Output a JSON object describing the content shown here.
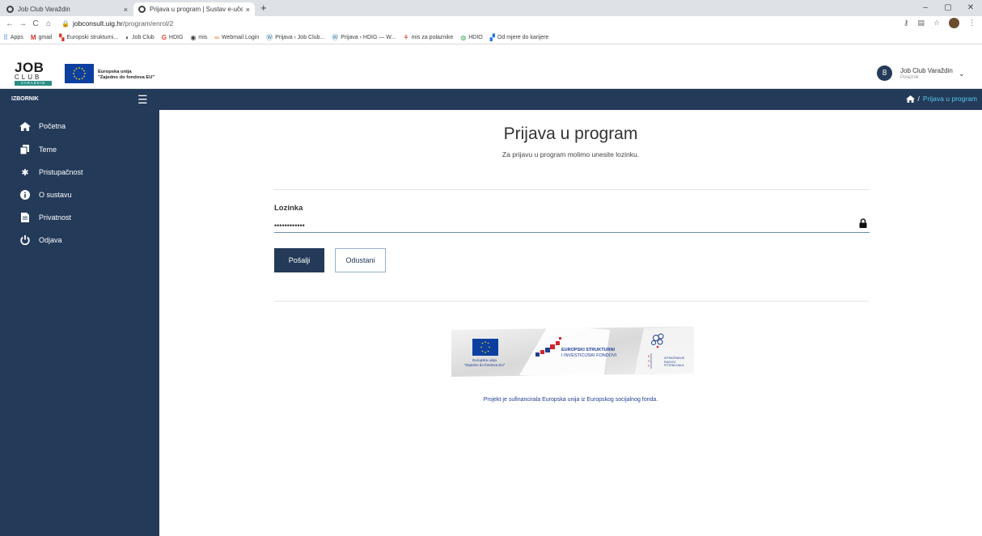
{
  "browser": {
    "tabs": [
      {
        "title": "Job Club Varaždin",
        "close": "×"
      },
      {
        "title": "Prijava u program | Sustav e-učen",
        "close": "×"
      }
    ],
    "new_tab": "+",
    "window_buttons": [
      "–",
      "▢",
      "✕"
    ],
    "nav": [
      "←",
      "→",
      "C",
      "⌂"
    ],
    "url_host": "jobconsult.uig.hr",
    "url_path": "/program/enrol/2",
    "bookmarks": [
      "Apps",
      "gmail",
      "Europski strukturni...",
      "Job Club",
      "HDIG",
      "mis",
      "Webmail Login",
      "Prijava ‹ Job Club...",
      "Prijava ‹ HDIG — W...",
      "mis za polaznike",
      "HDIO",
      "Od mjere do karijere"
    ]
  },
  "header": {
    "logo_line1": "JOB",
    "logo_line2": "CLUB",
    "logo_line3": "VARAŽDIN",
    "eu_line1": "Europska unija",
    "eu_line2": "\"Zajedno do fondova EU\"",
    "user_initial": "8",
    "user_name": "Job Club Varaždin",
    "user_role": "Polaznik",
    "user_caret": "⌄"
  },
  "topbar": {
    "menu_label": "IZBORNIK",
    "breadcrumb_sep": "/",
    "breadcrumb_current": "Prijava u program"
  },
  "sidebar": {
    "items": [
      {
        "label": "Početna"
      },
      {
        "label": "Teme"
      },
      {
        "label": "Pristupačnost"
      },
      {
        "label": "O sustavu"
      },
      {
        "label": "Privatnost"
      },
      {
        "label": "Odjava"
      }
    ]
  },
  "main": {
    "title": "Prijava u program",
    "subtitle": "Za prijavu u program molimo unesite lozinku.",
    "password_label": "Lozinka",
    "password_value": "••••••••••••",
    "send_label": "Pošalji",
    "cancel_label": "Odustani",
    "banner_eu_line1": "Europska unija",
    "banner_eu_line2": "\"Zajedno do fondova EU\"",
    "banner_esi_line1": "EUROPSKI STRUKTURNI",
    "banner_esi_line2": "I INVESTICIJSKI FONDOVI",
    "banner_esf_line1": "ISTRAŽIVANJE",
    "banner_esf_line2": "RAZVOJ",
    "banner_esf_line3": "POTENCIJALA",
    "footer_note": "Projekt je sufinancirala Europska unija iz Europskog socijalnog fonda."
  },
  "colors": {
    "primary": "#243a59",
    "accent": "#54c8e8",
    "eu_blue": "#0d3fa0",
    "logo_teal": "#2a8f86"
  }
}
